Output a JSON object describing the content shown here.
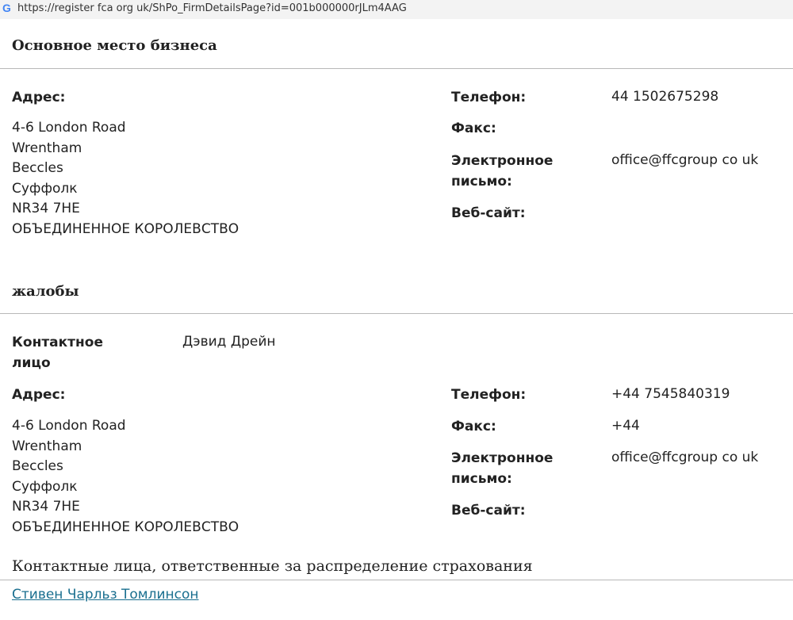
{
  "browser": {
    "icon": "google-g-icon",
    "url": "https://register fca org uk/ShPo_FirmDetailsPage?id=001b000000rJLm4AAG"
  },
  "principal": {
    "title": "Основное место бизнеса",
    "address_label": "Адрес:",
    "address_lines": [
      "4-6 London Road",
      "Wrentham",
      "Beccles",
      "Суффолк",
      "NR34 7HE",
      "ОБЪЕДИНЕННОЕ КОРОЛЕВСТВО"
    ],
    "phone_label": "Телефон:",
    "phone_value": "44 1502675298",
    "fax_label": "Факс:",
    "fax_value": "",
    "email_label_1": "Электронное",
    "email_label_2": "письмо:",
    "email_value": "office@ffcgroup co uk",
    "website_label": "Веб-сайт:",
    "website_value": ""
  },
  "complaints": {
    "title": "жалобы",
    "contact_label_1": "Контактное",
    "contact_label_2": "лицо",
    "contact_value": "Дэвид Дрейн",
    "address_label": "Адрес:",
    "address_lines": [
      "4-6 London Road",
      "Wrentham",
      "Beccles",
      "Суффолк",
      "NR34 7HE",
      "ОБЪЕДИНЕННОЕ КОРОЛЕВСТВО"
    ],
    "phone_label": "Телефон:",
    "phone_value": "+44 7545840319",
    "fax_label": "Факс:",
    "fax_value": "+44",
    "email_label_1": "Электронное",
    "email_label_2": "письмо:",
    "email_value": "office@ffcgroup co uk",
    "website_label": "Веб-сайт:",
    "website_value": ""
  },
  "insurance": {
    "title": "Контактные лица, ответственные за распределение страхования",
    "person_link": "Стивен Чарльз Томлинсон"
  }
}
